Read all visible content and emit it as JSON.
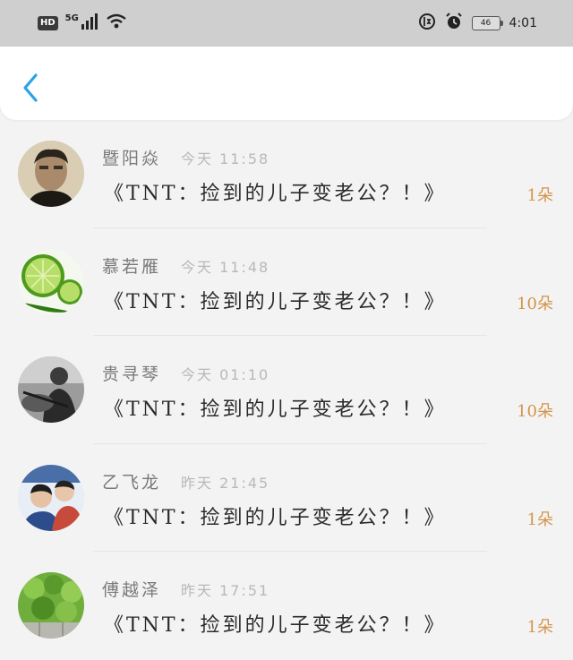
{
  "status_bar": {
    "hd": "HD",
    "network": "5G",
    "battery": "46",
    "time": "4:01",
    "icons": [
      "signal-icon",
      "wifi-icon",
      "data-saver-icon",
      "alarm-icon"
    ]
  },
  "colors": {
    "accent": "#2aa3e8",
    "count": "#d4944a",
    "status_bg": "#cfcfcf",
    "page_bg": "#f3f3f3"
  },
  "items": [
    {
      "name": "暨阳焱",
      "time": "今天 11:58",
      "content": "《TNT：捡到的儿子变老公？！》",
      "count": "1朵"
    },
    {
      "name": "慕若雁",
      "time": "今天 11:48",
      "content": "《TNT：捡到的儿子变老公？！》",
      "count": "10朵"
    },
    {
      "name": "贵寻琴",
      "time": "今天 01:10",
      "content": "《TNT：捡到的儿子变老公？！》",
      "count": "10朵"
    },
    {
      "name": "乙飞龙",
      "time": "昨天 21:45",
      "content": "《TNT：捡到的儿子变老公？！》",
      "count": "1朵"
    },
    {
      "name": "傅越泽",
      "time": "昨天 17:51",
      "content": "《TNT：捡到的儿子变老公？！》",
      "count": "1朵"
    }
  ]
}
